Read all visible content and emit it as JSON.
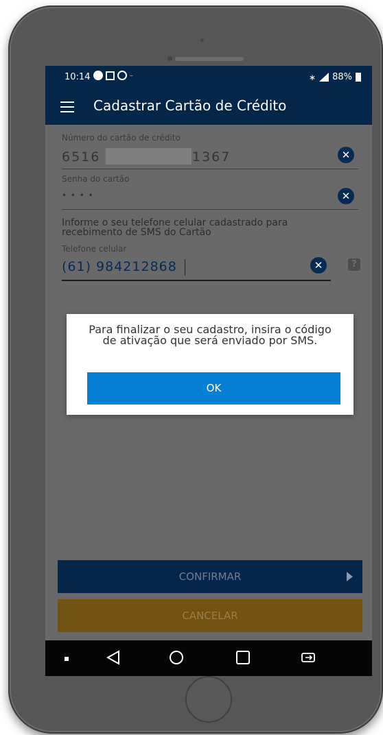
{
  "status_bar": {
    "time": "10:14",
    "battery": "88%",
    "dash": "–"
  },
  "app_bar": {
    "title": "Cadastrar Cartão de Crédito"
  },
  "form": {
    "card_number": {
      "label": "Número do cartão de crédito",
      "prefix": "6516",
      "suffix": "1367"
    },
    "card_password": {
      "label": "Senha do cartão",
      "value": "• • • •"
    },
    "info_text": "Informe o seu telefone celular cadastrado para recebimento de SMS do Cartão",
    "phone": {
      "label": "Telefone celular",
      "value": "(61) 984212868"
    },
    "help_icon": "?"
  },
  "buttons": {
    "confirm": "CONFIRMAR",
    "cancel": "CANCELAR"
  },
  "dialog": {
    "message": "Para finalizar o seu cadastro, insira o código de ativação que será enviado por SMS.",
    "ok": "OK"
  },
  "icons": {
    "clear": "close-circle-icon",
    "menu": "hamburger-menu-icon",
    "help": "help-icon"
  },
  "colors": {
    "app_bar": "#03264a",
    "dialog_button": "#0481d6",
    "cancel_button": "#725210"
  }
}
